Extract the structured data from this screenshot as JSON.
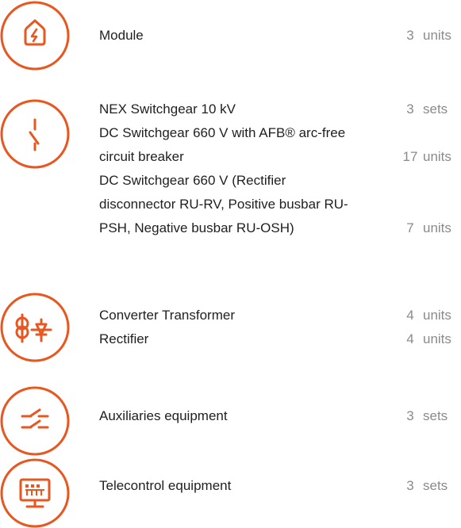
{
  "accent": "#e8571f",
  "groups": [
    {
      "icon": "house-lightning-icon",
      "items": [
        {
          "name": [
            "Module"
          ],
          "qty": "3",
          "unit": "units"
        }
      ]
    },
    {
      "icon": "switch-icon",
      "items": [
        {
          "name": [
            "NEX Switchgear 10 kV"
          ],
          "qty": "3",
          "unit": "sets"
        },
        {
          "name": [
            "DC Switchgear 660 V with AFB® arc-free",
            "circuit breaker"
          ],
          "qty": "17",
          "unit": "units"
        },
        {
          "name": [
            "DC Switchgear 660 V (Rectifier",
            "disconnector RU-RV, Positive busbar RU-",
            "PSH, Negative busbar RU-OSH)"
          ],
          "qty": "7",
          "unit": "units"
        }
      ]
    },
    {
      "icon": "transformer-rectifier-icon",
      "items": [
        {
          "name": [
            "Converter Transformer"
          ],
          "qty": "4",
          "unit": "units"
        },
        {
          "name": [
            "Rectifier"
          ],
          "qty": "4",
          "unit": "units"
        }
      ]
    },
    {
      "icon": "auxiliary-switches-icon",
      "items": [
        {
          "name": [
            "Auxiliaries equipment"
          ],
          "qty": "3",
          "unit": "sets"
        }
      ]
    },
    {
      "icon": "monitor-icon",
      "items": [
        {
          "name": [
            "Telecontrol equipment"
          ],
          "qty": "3",
          "unit": "sets"
        }
      ]
    }
  ]
}
